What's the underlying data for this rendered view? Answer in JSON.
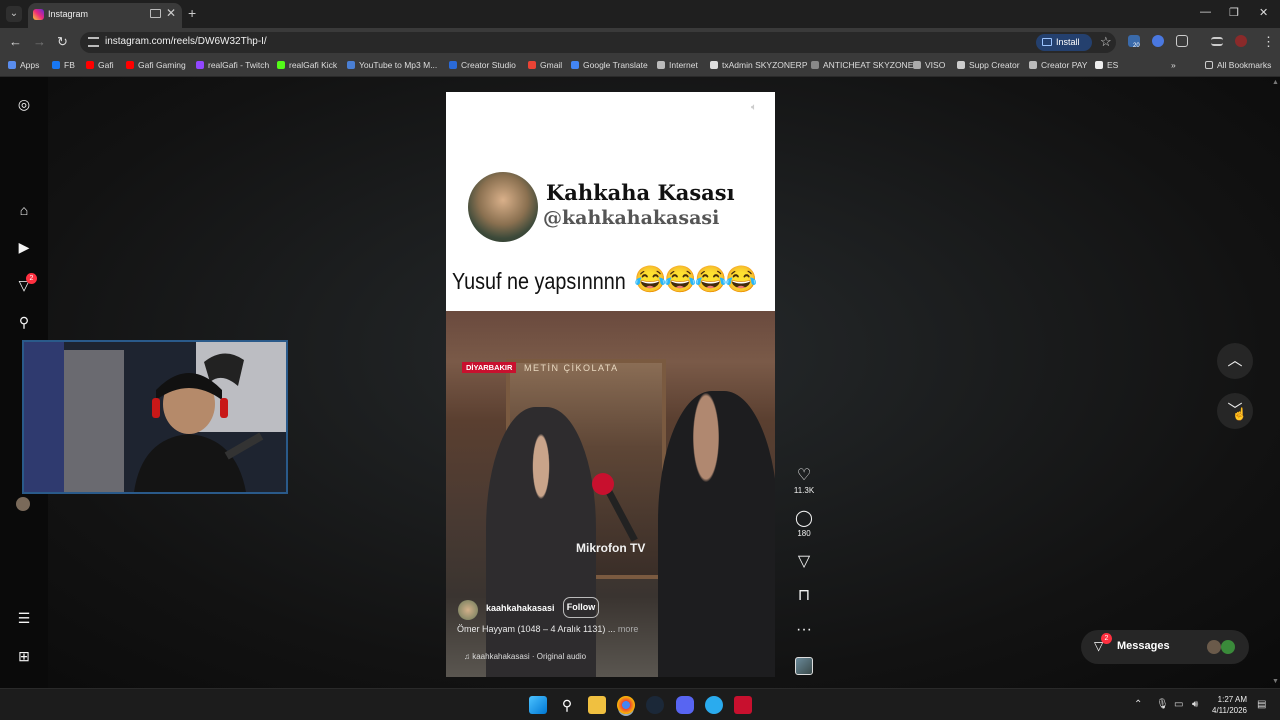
{
  "browser": {
    "tab_title": "Instagram",
    "url": "instagram.com/reels/DW6W32Thp-I/",
    "install_label": "Install",
    "new_tab": "+",
    "close_tab": "✕",
    "ext_badge": "20"
  },
  "bookmarks": [
    {
      "label": "Apps",
      "color": "#5a8dee"
    },
    {
      "label": "FB",
      "color": "#1877f2"
    },
    {
      "label": "Gafi",
      "color": "#ff0000"
    },
    {
      "label": "Gafi Gaming",
      "color": "#ff0000"
    },
    {
      "label": "realGafi - Twitch",
      "color": "#9146ff"
    },
    {
      "label": "realGafi Kick",
      "color": "#53fc18"
    },
    {
      "label": "YouTube to Mp3 M...",
      "color": "#4a7fd4"
    },
    {
      "label": "Creator Studio",
      "color": "#2a6ad8"
    },
    {
      "label": "Gmail",
      "color": "#ea4335"
    },
    {
      "label": "Google Translate",
      "color": "#4285f4"
    },
    {
      "label": "Internet",
      "color": "#bbbbbb"
    },
    {
      "label": "txAdmin SKYZONERP",
      "color": "#dddddd"
    },
    {
      "label": "ANTICHEAT SKYZONE",
      "color": "#888888"
    },
    {
      "label": "VISO",
      "color": "#aaaaaa"
    },
    {
      "label": "Supp Creator",
      "color": "#cccccc"
    },
    {
      "label": "Creator PAY",
      "color": "#bbbbbb"
    },
    {
      "label": "ES",
      "color": "#eeeeee"
    }
  ],
  "all_bookmarks": "All Bookmarks",
  "sidebar": {
    "notification_count": "2"
  },
  "reel": {
    "channel_name": "Kahkaha Kasası",
    "channel_handle": "@kahkahakasasi",
    "caption": "Yusuf ne yapsınnnn",
    "emojis": "😂😂😂😂",
    "location_tag": "DİYARBAKIR",
    "shop_sign": "METİN ÇİKOLATA",
    "watermark": "Mikrofon TV",
    "owner": "kaahkahakasasi",
    "follow_label": "Follow",
    "description": "Ömer Hayyam (1048 – 4 Aralık 1131) ...",
    "more_label": "more",
    "audio": "kaahkahakasasi · Original audio"
  },
  "actions": {
    "likes": "11.3K",
    "comments": "180"
  },
  "messages": {
    "label": "Messages",
    "badge": "2"
  },
  "clock": {
    "time": "1:27 AM",
    "date": "4/11/2026"
  }
}
